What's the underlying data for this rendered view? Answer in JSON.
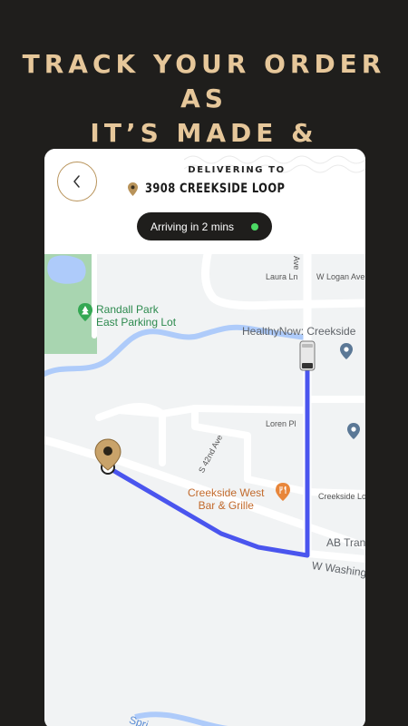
{
  "headline": {
    "line1": "TRACK YOUR ORDER AS",
    "line2": "IT’S MADE & DELIVERED"
  },
  "header": {
    "delivering_label": "DELIVERING TO",
    "address": "3908 CREEKSIDE LOOP"
  },
  "status": {
    "text": "Arriving in 2 mins",
    "dot_color": "#4cd964"
  },
  "map": {
    "labels": {
      "park_line1": "Randall Park",
      "park_line2": "East Parking Lot",
      "healthynow": "HealthyNow: Creekside",
      "laura": "Laura Ln",
      "logan": "W Logan Ave",
      "ave_top": "Ave",
      "loren": "Loren Pl",
      "s42nd": "S 42nd Ave",
      "creekside_line1": "Creekside West",
      "creekside_line2": "Bar & Grille",
      "creekside_lo": "Creekside Lo",
      "ab_tran": "AB Tran",
      "w_washing": "W Washing",
      "spri": "Spri"
    },
    "route_color": "#4a55ee",
    "brand_color": "#b8935a"
  },
  "icons": {
    "back": "chevron-left-icon",
    "address_pin": "location-pin-icon",
    "destination_pin": "destination-pin-icon",
    "vehicle": "delivery-van-icon",
    "park": "park-tree-icon",
    "restaurant": "restaurant-icon"
  }
}
